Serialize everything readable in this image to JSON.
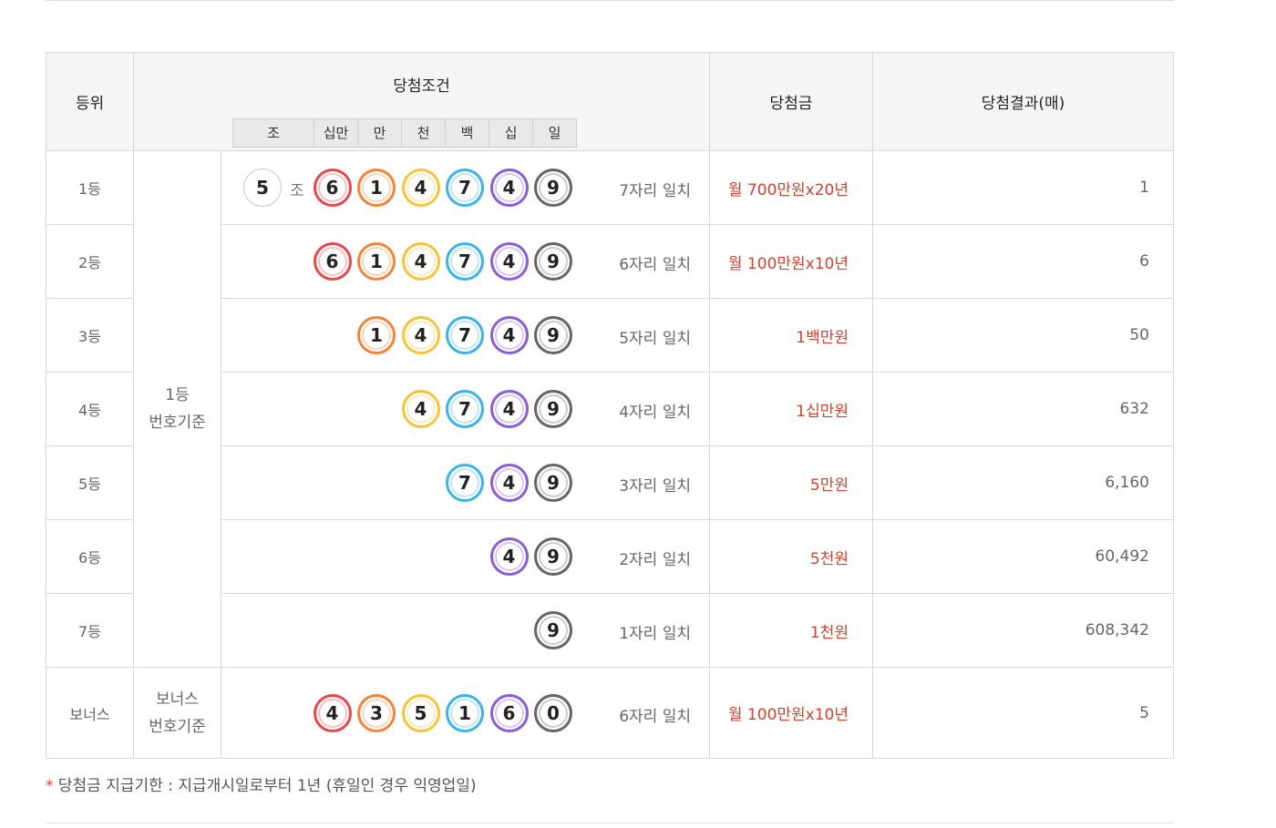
{
  "header": {
    "rank": "등위",
    "condition": "당첨조건",
    "prize": "당첨금",
    "result": "당첨결과(매)",
    "digits": [
      "조",
      "십만",
      "만",
      "천",
      "백",
      "십",
      "일"
    ]
  },
  "colors": {
    "ball_6": "#e8474b",
    "ball_1": "#f4843a",
    "ball_4": "#f5c43c",
    "ball_7": "#3cb4e8",
    "ball_4b": "#8a5fd6",
    "ball_9": "#666666",
    "prize_red": "#d7402c"
  },
  "group_label": {
    "line1": "1등",
    "line2": "번호기준"
  },
  "jo_label": "조",
  "rows": [
    {
      "rank": "1등",
      "jo": "5",
      "balls": [
        "6",
        "1",
        "4",
        "7",
        "4",
        "9"
      ],
      "match": "7자리 일치",
      "prize": "월 700만원x20년",
      "count": "1"
    },
    {
      "rank": "2등",
      "balls": [
        "6",
        "1",
        "4",
        "7",
        "4",
        "9"
      ],
      "match": "6자리 일치",
      "prize": "월 100만원x10년",
      "count": "6"
    },
    {
      "rank": "3등",
      "balls": [
        "1",
        "4",
        "7",
        "4",
        "9"
      ],
      "match": "5자리 일치",
      "prize": "1백만원",
      "count": "50"
    },
    {
      "rank": "4등",
      "balls": [
        "4",
        "7",
        "4",
        "9"
      ],
      "match": "4자리 일치",
      "prize": "1십만원",
      "count": "632"
    },
    {
      "rank": "5등",
      "balls": [
        "7",
        "4",
        "9"
      ],
      "match": "3자리 일치",
      "prize": "5만원",
      "count": "6,160"
    },
    {
      "rank": "6등",
      "balls": [
        "4",
        "9"
      ],
      "match": "2자리 일치",
      "prize": "5천원",
      "count": "60,492"
    },
    {
      "rank": "7등",
      "balls": [
        "9"
      ],
      "match": "1자리 일치",
      "prize": "1천원",
      "count": "608,342"
    }
  ],
  "bonus": {
    "rank": "보너스",
    "label_line1": "보너스",
    "label_line2": "번호기준",
    "balls": [
      "4",
      "3",
      "5",
      "1",
      "6",
      "0"
    ],
    "match": "6자리 일치",
    "prize": "월 100만원x10년",
    "count": "5"
  },
  "note": {
    "star": "*",
    "text": "당첨금 지급기한 : 지급개시일로부터 1년 (휴일인 경우 익영업일)"
  }
}
